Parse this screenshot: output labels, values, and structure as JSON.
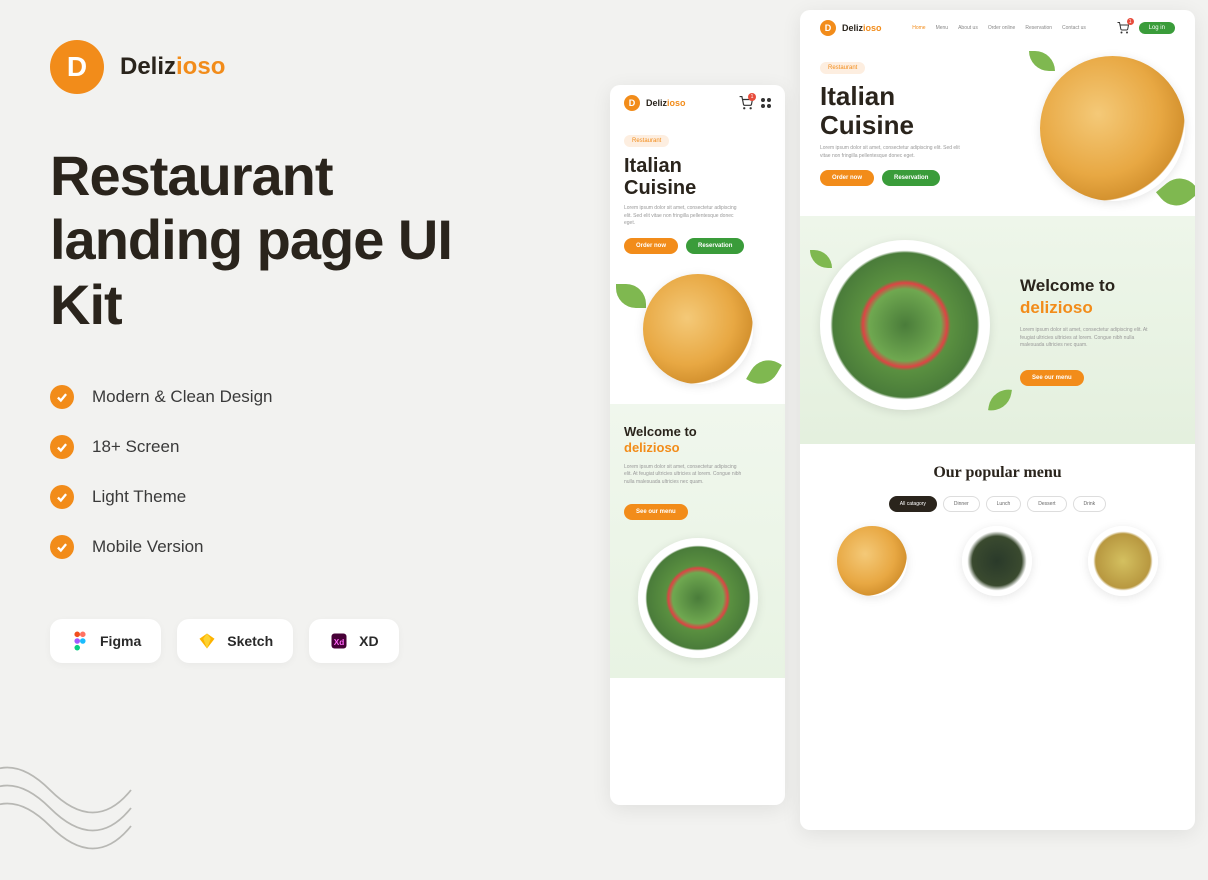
{
  "brand": {
    "letter": "D",
    "name_black": "Deliz",
    "name_orange": "ioso"
  },
  "headline": "Restaurant landing page UI Kit",
  "features": [
    "Modern & Clean Design",
    "18+ Screen",
    "Light Theme",
    "Mobile Version"
  ],
  "tools": [
    {
      "name": "Figma"
    },
    {
      "name": "Sketch"
    },
    {
      "name": "XD"
    }
  ],
  "preview": {
    "badge": "Restaurant",
    "hero_title_1": "Italian",
    "hero_title_2": "Cuisine",
    "hero_desc": "Lorem ipsum dolor sit amet, consectetur adipiscing elit. Sed elit vitae non fringilla pellentesque donec eget.",
    "btn_order": "Order now",
    "btn_reserve": "Reservation",
    "welcome_line1": "Welcome to",
    "welcome_line2": "delizioso",
    "welcome_desc": "Lorem ipsum dolor sit amet, consectetur adipiscing elit. At feugiat ultricies ultricies at lorem. Congue nibh nulla malesuada ultricies nec quam.",
    "btn_menu": "See our menu",
    "popular_title": "Our popular menu",
    "nav": [
      "Home",
      "Menu",
      "About us",
      "Order online",
      "Reservation",
      "Contact us"
    ],
    "login": "Log in",
    "tabs": [
      "All catagory",
      "Dinner",
      "Lunch",
      "Dessert",
      "Drink"
    ],
    "cart_count": "1"
  }
}
